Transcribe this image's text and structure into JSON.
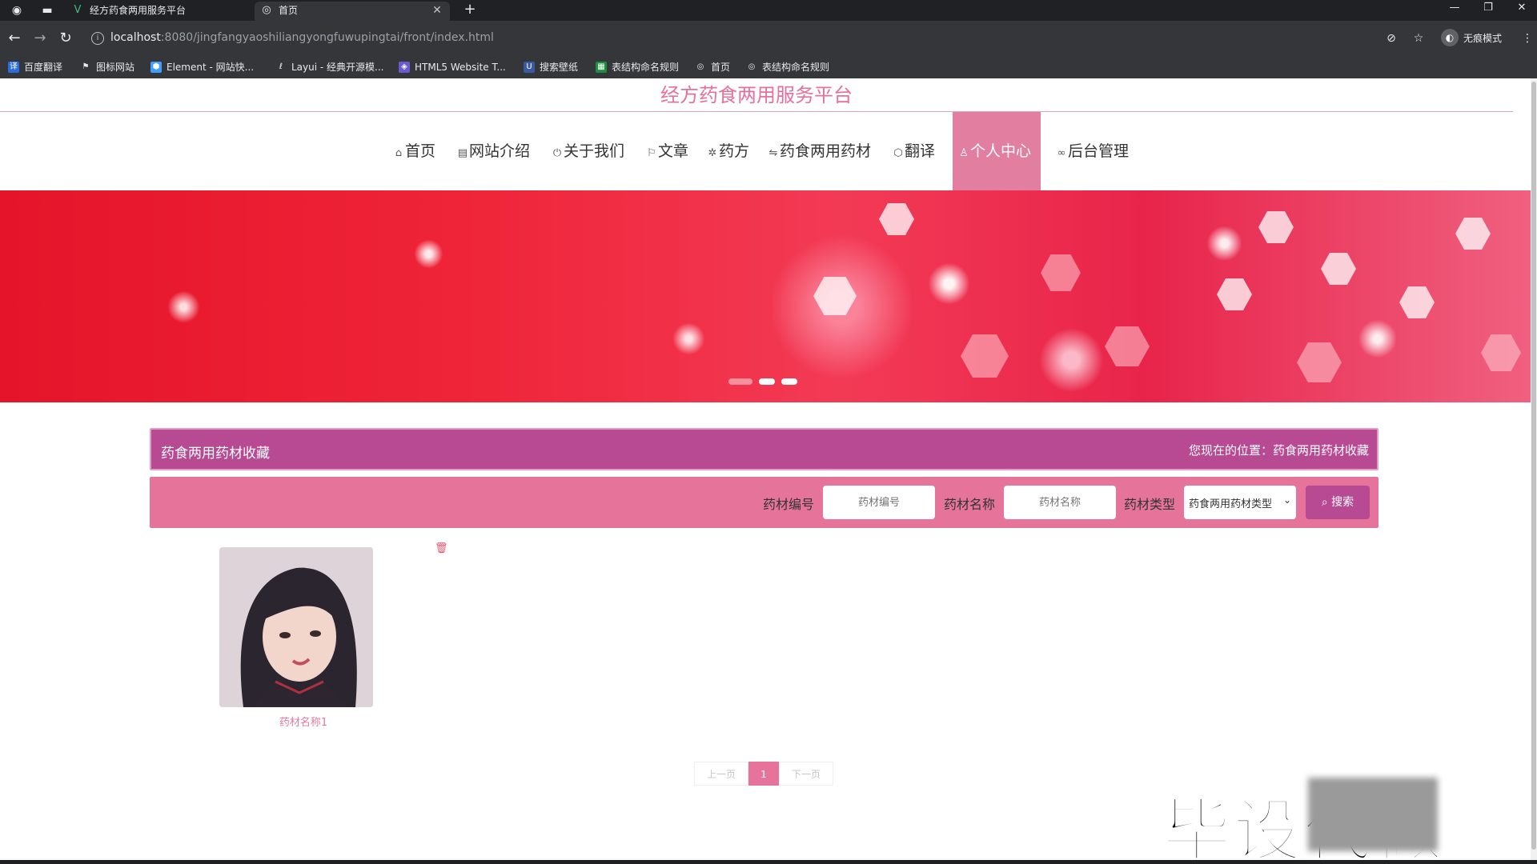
{
  "browser": {
    "tabs": [
      {
        "title": "经方药食两用服务平台",
        "state": "inactive"
      },
      {
        "title": "首页",
        "state": "active"
      }
    ],
    "new_tab_label": "+",
    "url_host": "localhost",
    "url_rest": ":8080/jingfangyaoshiliangyongfuwupingtai/front/index.html",
    "profile_label": "无痕模式",
    "bookmarks": [
      {
        "label": "百度翻译",
        "icon": "baidu-translate-icon",
        "color": "#2b6de0"
      },
      {
        "label": "图标网站",
        "icon": "flag-icon",
        "color": "#5f6368"
      },
      {
        "label": "Element - 网站快...",
        "icon": "element-icon",
        "color": "#409eff"
      },
      {
        "label": "Layui - 经典开源模...",
        "icon": "layui-icon",
        "color": "#5f6368"
      },
      {
        "label": "HTML5 Website T...",
        "icon": "html5-icon",
        "color": "#6a5acd"
      },
      {
        "label": "搜索壁纸",
        "icon": "wallpaper-icon",
        "color": "#3a5ba0"
      },
      {
        "label": "表结构命名规则",
        "icon": "sheet-icon",
        "color": "#1e8e3e"
      },
      {
        "label": "首页",
        "icon": "globe-icon",
        "color": "#5f6368"
      },
      {
        "label": "表结构命名规则",
        "icon": "globe-icon",
        "color": "#5f6368"
      }
    ]
  },
  "site": {
    "title": "经方药食两用服务平台",
    "nav": [
      {
        "label": "首页",
        "icon": "home-icon",
        "glyph": "⌂"
      },
      {
        "label": "网站介绍",
        "icon": "newspaper-icon",
        "glyph": "▤"
      },
      {
        "label": "关于我们",
        "icon": "power-icon",
        "glyph": "⏻"
      },
      {
        "label": "文章",
        "icon": "flag-icon",
        "glyph": "⚐"
      },
      {
        "label": "药方",
        "icon": "gear-icon",
        "glyph": "✲"
      },
      {
        "label": "药食两用药材",
        "icon": "sliders-icon",
        "glyph": "⇋"
      },
      {
        "label": "翻译",
        "icon": "cube-icon",
        "glyph": "⬡"
      },
      {
        "label": "个人中心",
        "icon": "user-icon",
        "glyph": "ℛ",
        "active": true
      },
      {
        "label": "后台管理",
        "icon": "link-icon",
        "glyph": "∞"
      }
    ],
    "carousel_active_index": 1,
    "carousel_count": 3
  },
  "section": {
    "title": "药食两用药材收藏",
    "location_label": "您现在的位置：",
    "location_value": "药食两用药材收藏"
  },
  "search": {
    "code_label": "药材编号",
    "code_placeholder": "药材编号",
    "name_label": "药材名称",
    "name_placeholder": "药材名称",
    "type_label": "药材类型",
    "type_selected": "药食两用药材类型",
    "button_label": "搜索"
  },
  "items": [
    {
      "name": "药材名称1"
    }
  ],
  "pagination": {
    "prev": "上一页",
    "current": "1",
    "next": "下一页"
  },
  "watermark": {
    "text": "毕设",
    "hidden_text": "代做"
  },
  "colors": {
    "accent_pink": "#e5739a",
    "accent_purple": "#b84a93",
    "title_pink": "#e7709a"
  }
}
